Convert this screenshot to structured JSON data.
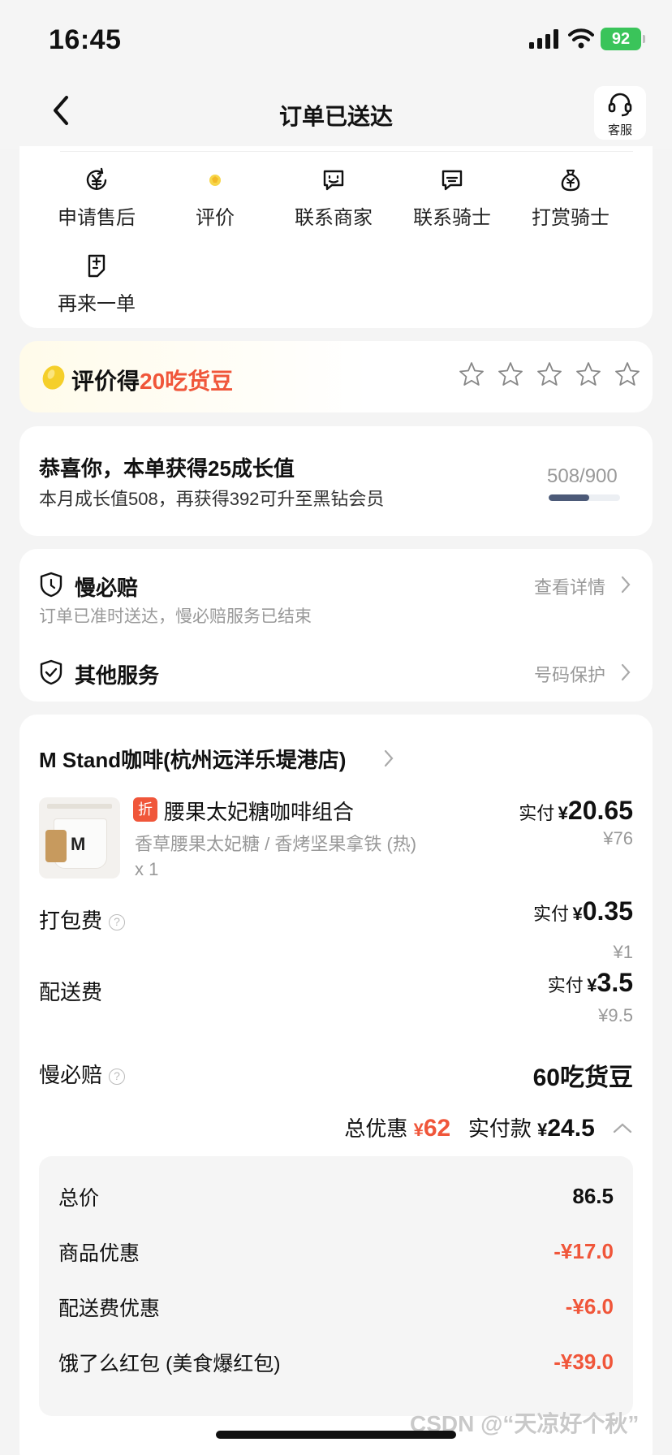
{
  "status_bar": {
    "time": "16:45",
    "battery": "92"
  },
  "nav": {
    "title": "订单已送达",
    "service_label": "客服"
  },
  "actions": [
    {
      "label": "申请售后",
      "icon": "yuan-refund-icon"
    },
    {
      "label": "评价",
      "icon": "review-icon"
    },
    {
      "label": "联系商家",
      "icon": "chat-icon"
    },
    {
      "label": "联系骑士",
      "icon": "chat-icon"
    },
    {
      "label": "打赏骑士",
      "icon": "money-bag-icon"
    },
    {
      "label": "再来一单",
      "icon": "reorder-icon"
    }
  ],
  "review_banner": {
    "prefix": "评价得",
    "highlight": "20吃货豆",
    "stars": 5
  },
  "growth": {
    "title": "恭喜你，本单获得25成长值",
    "subtitle": "本月成长值508，再获得392可升至黑钻会员",
    "progress_text": "508/900",
    "progress_fraction": 0.564
  },
  "services": {
    "slow_pay": {
      "name": "慢必赔",
      "link": "查看详情",
      "desc": "订单已准时送达，慢必赔服务已结束"
    },
    "other": {
      "name": "其他服务",
      "link": "号码保护"
    }
  },
  "order": {
    "store": "M Stand咖啡(杭州远洋乐堤港店)",
    "item": {
      "tag": "折",
      "name": "腰果太妃糖咖啡组合",
      "spec": "香草腰果太妃糖 / 香烤坚果拿铁 (热)",
      "qty": "x 1",
      "paid_label": "实付",
      "currency": "¥",
      "paid": "20.65",
      "original": "¥76"
    },
    "packing": {
      "label": "打包费",
      "paid_label": "实付",
      "currency": "¥",
      "paid": "0.35",
      "original": "¥1"
    },
    "delivery": {
      "label": "配送费",
      "paid_label": "实付",
      "currency": "¥",
      "paid": "3.5",
      "original": "¥9.5"
    },
    "slow_pay": {
      "label": "慢必赔",
      "value": "60吃货豆"
    },
    "summary": {
      "discount_label": "总优惠",
      "currency": "¥",
      "discount": "62",
      "paid_label": "实付款",
      "paid": "24.5"
    },
    "breakdown": [
      {
        "label": "总价",
        "value": "86.5",
        "red": false
      },
      {
        "label": "商品优惠",
        "value": "-¥17.0",
        "red": true
      },
      {
        "label": "配送费优惠",
        "value": "-¥6.0",
        "red": true
      },
      {
        "label": "饿了么红包 (美食爆红包)",
        "value": "-¥39.0",
        "red": true
      }
    ]
  },
  "watermark": "CSDN @“天凉好个秋”",
  "colors": {
    "accent": "#f0563a",
    "progress": "#4c5a78",
    "battery": "#3ac45a"
  }
}
